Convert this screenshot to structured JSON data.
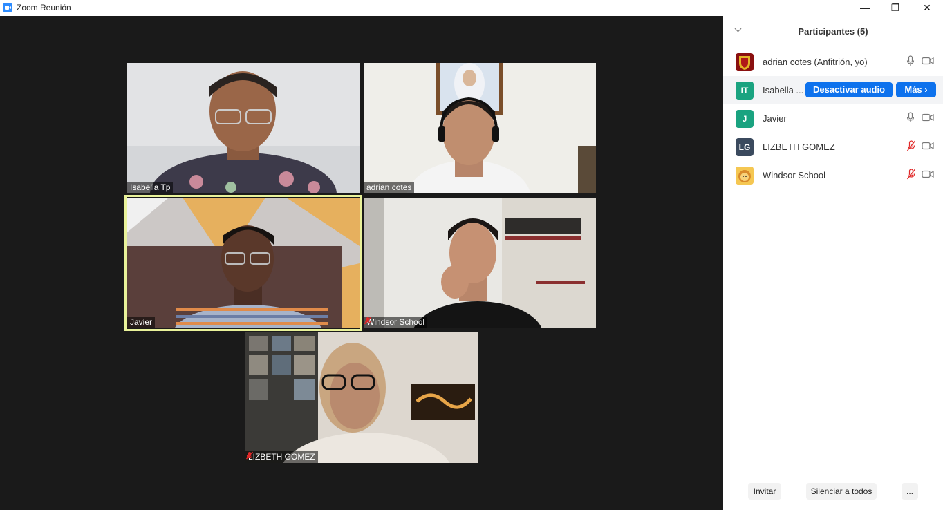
{
  "window": {
    "title": "Zoom Reunión",
    "controls": {
      "minimize": "—",
      "maximize": "❐",
      "close": "✕"
    }
  },
  "video_grid": {
    "tiles": [
      {
        "name": "Isabella Tp",
        "muted": false
      },
      {
        "name": "adrian cotes",
        "muted": false
      },
      {
        "name": "Javier",
        "muted": false,
        "active_speaker": true
      },
      {
        "name": "Windsor School",
        "muted": true
      },
      {
        "name": "LIZBETH GOMEZ",
        "muted": true
      }
    ]
  },
  "participants_panel": {
    "title": "Participantes (5)",
    "rows": [
      {
        "avatar_text": "",
        "avatar_icon": "crest-image",
        "name": "adrian cotes (Anfitrión, yo)",
        "mic": "on",
        "video": "off"
      },
      {
        "avatar_text": "IT",
        "avatar_color": "#1aa380",
        "name": "Isabella ...",
        "hover": true,
        "mute_button": "Desactivar audio",
        "more_button": "Más"
      },
      {
        "avatar_text": "J",
        "avatar_color": "#1aa380",
        "name": "Javier",
        "mic": "on",
        "video": "off"
      },
      {
        "avatar_text": "LG",
        "avatar_color": "#3b4a5e",
        "name": "LIZBETH GOMEZ",
        "mic": "muted",
        "video": "off"
      },
      {
        "avatar_text": "",
        "avatar_icon": "lion-image",
        "name": "Windsor School",
        "mic": "muted",
        "video": "off"
      }
    ],
    "footer": {
      "invite": "Invitar",
      "mute_all": "Silenciar a todos",
      "more": "..."
    }
  },
  "colors": {
    "accent": "#0e72ed",
    "stage_bg": "#1a1a1a",
    "active_speaker_border": "#e9f29a",
    "muted_red": "#e02828"
  }
}
